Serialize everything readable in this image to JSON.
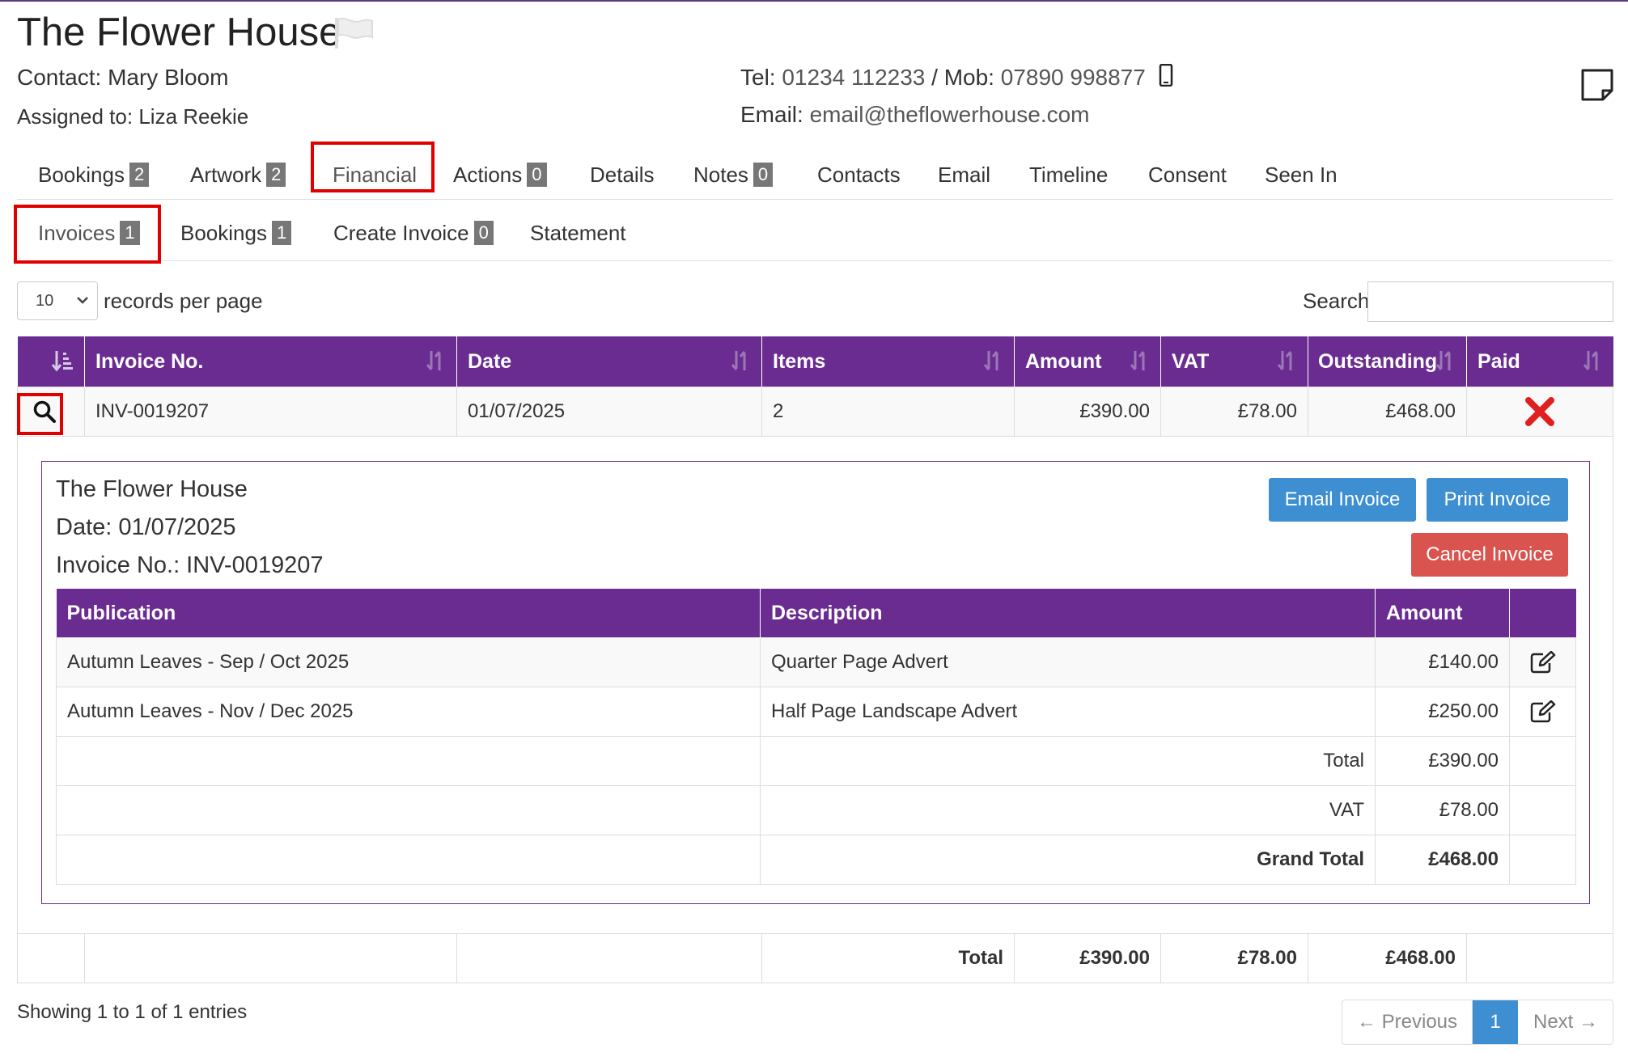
{
  "header": {
    "company": "The Flower House",
    "contact_label": "Contact:",
    "contact_name": "Mary Bloom",
    "assigned_label": "Assigned to:",
    "assigned_name": "Liza Reekie",
    "tel_label": "Tel:",
    "tel": "01234 112233",
    "mob_label": "/ Mob:",
    "mob": "07890 998877",
    "email_label": "Email:",
    "email": "email@theflowerhouse.com"
  },
  "tabs": [
    {
      "label": "Bookings",
      "badge": "2"
    },
    {
      "label": "Artwork",
      "badge": "2"
    },
    {
      "label": "Financial",
      "badge": ""
    },
    {
      "label": "Actions",
      "badge": "0"
    },
    {
      "label": "Details",
      "badge": ""
    },
    {
      "label": "Notes",
      "badge": "0"
    },
    {
      "label": "Contacts",
      "badge": ""
    },
    {
      "label": "Email",
      "badge": ""
    },
    {
      "label": "Timeline",
      "badge": ""
    },
    {
      "label": "Consent",
      "badge": ""
    },
    {
      "label": "Seen In",
      "badge": ""
    }
  ],
  "subtabs": [
    {
      "label": "Invoices",
      "badge": "1"
    },
    {
      "label": "Bookings",
      "badge": "1"
    },
    {
      "label": "Create Invoice",
      "badge": "0"
    },
    {
      "label": "Statement",
      "badge": ""
    }
  ],
  "list_controls": {
    "page_length": "10",
    "records_label": "records per page",
    "search_label": "Search:",
    "search_value": ""
  },
  "invoices_table": {
    "columns": [
      "",
      "Invoice No.",
      "Date",
      "Items",
      "Amount",
      "VAT",
      "Outstanding",
      "Paid"
    ],
    "rows": [
      {
        "invoice_no": "INV-0019207",
        "date": "01/07/2025",
        "items": "2",
        "amount": "£390.00",
        "vat": "£78.00",
        "outstanding": "£468.00",
        "paid": false
      }
    ],
    "footer": {
      "label": "Total",
      "amount": "£390.00",
      "vat": "£78.00",
      "outstanding": "£468.00"
    }
  },
  "invoice_detail": {
    "company": "The Flower House",
    "date_line": "Date: 01/07/2025",
    "invoice_line": "Invoice No.: INV-0019207",
    "buttons": {
      "email": "Email Invoice",
      "print": "Print Invoice",
      "cancel": "Cancel Invoice"
    },
    "columns": [
      "Publication",
      "Description",
      "Amount",
      ""
    ],
    "lines": [
      {
        "publication": "Autumn Leaves - Sep / Oct 2025",
        "description": "Quarter Page Advert",
        "amount": "£140.00"
      },
      {
        "publication": "Autumn Leaves - Nov / Dec 2025",
        "description": "Half Page Landscape Advert",
        "amount": "£250.00"
      }
    ],
    "totals": [
      {
        "label": "Total",
        "value": "£390.00",
        "bold": false
      },
      {
        "label": "VAT",
        "value": "£78.00",
        "bold": false
      },
      {
        "label": "Grand Total",
        "value": "£468.00",
        "bold": true
      }
    ]
  },
  "pagination": {
    "info": "Showing 1 to 1 of 1 entries",
    "previous": "← Previous",
    "current": "1",
    "next": "Next →"
  },
  "colors": {
    "brand_purple": "#6a2c91",
    "button_blue": "#3d8fd1",
    "button_red": "#d9534f",
    "highlight_red": "#e00000"
  }
}
